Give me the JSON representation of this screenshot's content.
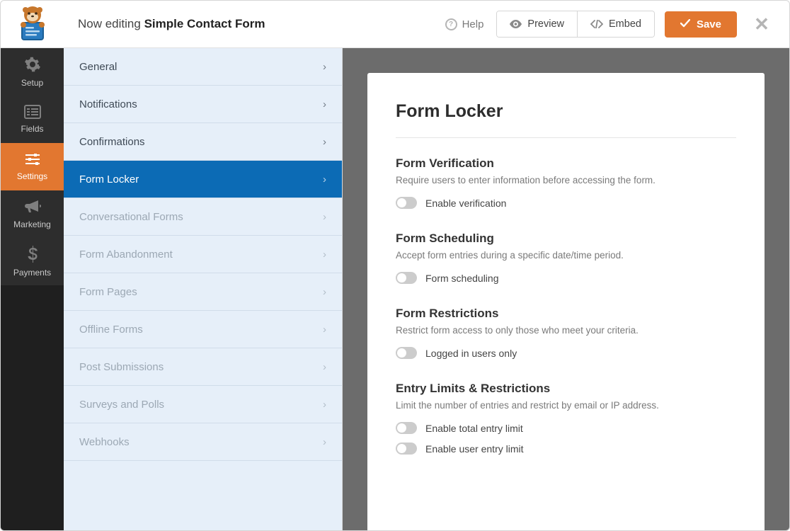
{
  "topbar": {
    "editing_prefix": "Now editing ",
    "form_name": "Simple Contact Form",
    "help_label": "Help",
    "preview_label": "Preview",
    "embed_label": "Embed",
    "save_label": "Save"
  },
  "rail": [
    {
      "id": "setup",
      "label": "Setup",
      "icon": "gear"
    },
    {
      "id": "fields",
      "label": "Fields",
      "icon": "list"
    },
    {
      "id": "settings",
      "label": "Settings",
      "icon": "sliders",
      "active": true
    },
    {
      "id": "marketing",
      "label": "Marketing",
      "icon": "bullhorn"
    },
    {
      "id": "payments",
      "label": "Payments",
      "icon": "dollar"
    }
  ],
  "settings_menu": [
    {
      "label": "General"
    },
    {
      "label": "Notifications"
    },
    {
      "label": "Confirmations"
    },
    {
      "label": "Form Locker",
      "active": true
    },
    {
      "label": "Conversational Forms",
      "disabled": true
    },
    {
      "label": "Form Abandonment",
      "disabled": true
    },
    {
      "label": "Form Pages",
      "disabled": true
    },
    {
      "label": "Offline Forms",
      "disabled": true
    },
    {
      "label": "Post Submissions",
      "disabled": true
    },
    {
      "label": "Surveys and Polls",
      "disabled": true
    },
    {
      "label": "Webhooks",
      "disabled": true
    }
  ],
  "panel": {
    "title": "Form Locker",
    "sections": [
      {
        "heading": "Form Verification",
        "desc": "Require users to enter information before accessing the form.",
        "toggles": [
          {
            "label": "Enable verification",
            "on": false
          }
        ]
      },
      {
        "heading": "Form Scheduling",
        "desc": "Accept form entries during a specific date/time period.",
        "toggles": [
          {
            "label": "Form scheduling",
            "on": false
          }
        ]
      },
      {
        "heading": "Form Restrictions",
        "desc": "Restrict form access to only those who meet your criteria.",
        "toggles": [
          {
            "label": "Logged in users only",
            "on": false
          }
        ]
      },
      {
        "heading": "Entry Limits & Restrictions",
        "desc": "Limit the number of entries and restrict by email or IP address.",
        "toggles": [
          {
            "label": "Enable total entry limit",
            "on": false
          },
          {
            "label": "Enable user entry limit",
            "on": false
          }
        ]
      }
    ]
  }
}
